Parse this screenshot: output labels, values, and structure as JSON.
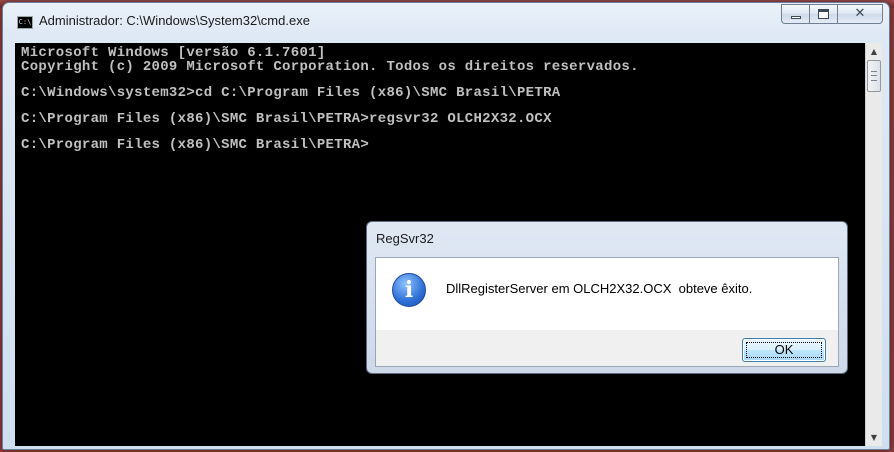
{
  "window": {
    "title": "Administrador: C:\\Windows\\System32\\cmd.exe",
    "icon": "cmd-icon",
    "icon_text": "C:\\",
    "buttons": {
      "minimize": "minimize",
      "maximize": "maximize",
      "close": "✕"
    }
  },
  "console": {
    "lines": [
      "Microsoft Windows [versão 6.1.7601]",
      "Copyright (c) 2009 Microsoft Corporation. Todos os direitos reservados.",
      "",
      "C:\\Windows\\system32>cd C:\\Program Files (x86)\\SMC Brasil\\PETRA",
      "",
      "C:\\Program Files (x86)\\SMC Brasil\\PETRA>regsvr32 OLCH2X32.OCX",
      "",
      "C:\\Program Files (x86)\\SMC Brasil\\PETRA>"
    ],
    "text_color": "#c0c0c0",
    "background": "#000000"
  },
  "scrollbar": {
    "up": "▲",
    "down": "▼"
  },
  "dialog": {
    "title": "RegSvr32",
    "icon": "info-icon",
    "icon_glyph": "i",
    "message": "DllRegisterServer em OLCH2X32.OCX  obteve êxito.",
    "ok_label": "OK"
  }
}
